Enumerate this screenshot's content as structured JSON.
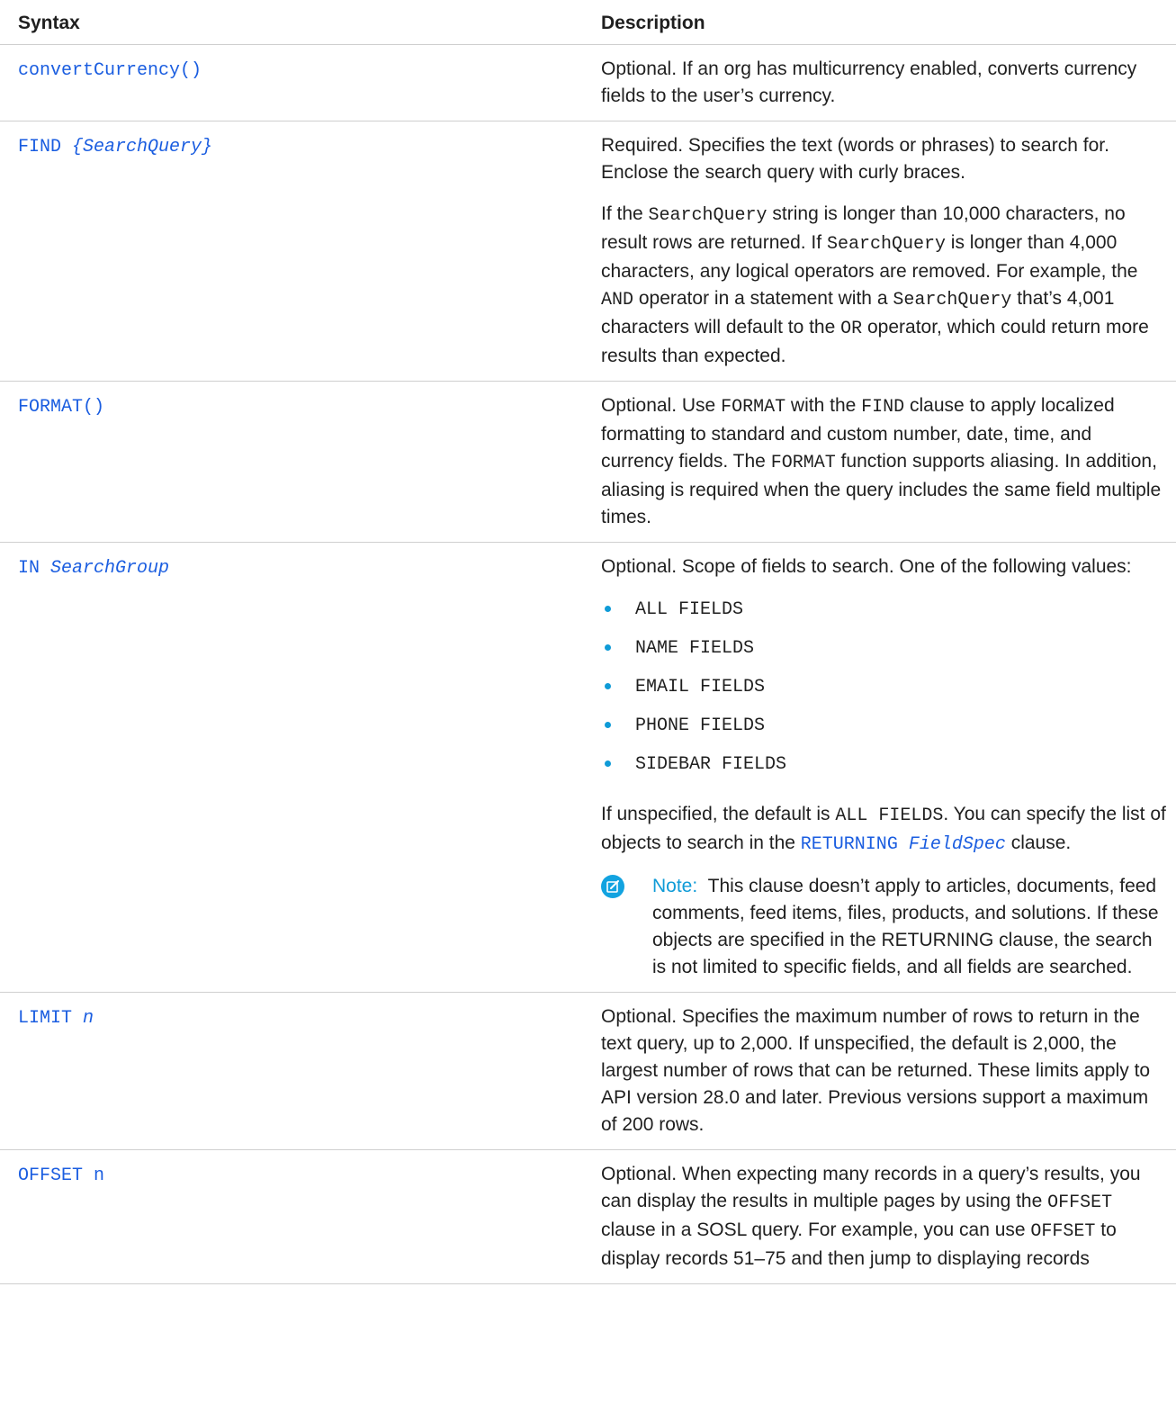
{
  "header": {
    "syntax": "Syntax",
    "description": "Description"
  },
  "rows": [
    {
      "syntax": "convertCurrency()",
      "desc": "Optional. If an org has multicurrency enabled, converts currency fields to the user’s currency."
    },
    {
      "syntax_kw": "FIND",
      "syntax_arg": "{SearchQuery}",
      "desc1": "Required. Specifies the text (words or phrases) to search for. Enclose the search query with curly braces.",
      "p2": {
        "t1": "If the ",
        "c1": "SearchQuery",
        "t2": " string is longer than 10,000 characters, no result rows are returned. If ",
        "c2": "SearchQuery",
        "t3": " is longer than 4,000 characters, any logical operators are removed. For example, the ",
        "c3": "AND",
        "t4": " operator in a statement with a ",
        "c4": "SearchQuery",
        "t5": " that’s 4,001 characters will default to the ",
        "c5": "OR",
        "t6": " operator, which could return more results than expected."
      }
    },
    {
      "syntax": "FORMAT()",
      "p": {
        "t1": "Optional. Use ",
        "c1": "FORMAT",
        "t2": " with the ",
        "c2": "FIND",
        "t3": " clause to apply localized formatting to standard and custom number, date, time, and currency fields. The ",
        "c3": "FORMAT",
        "t4": " function supports aliasing. In addition, aliasing is required when the query includes the same field multiple times."
      }
    },
    {
      "syntax_kw": "IN",
      "syntax_arg": "SearchGroup",
      "desc1": "Optional. Scope of fields to search. One of the following values:",
      "values": [
        "ALL FIELDS",
        "NAME FIELDS",
        "EMAIL FIELDS",
        "PHONE FIELDS",
        "SIDEBAR FIELDS"
      ],
      "p2": {
        "t1": "If unspecified, the default is ",
        "c1": "ALL FIELDS",
        "t2": ". You can specify the list of objects to search in the ",
        "link_kw": "RETURNING",
        "link_arg": "FieldSpec",
        "t3": " clause."
      },
      "note": {
        "label": "Note:",
        "text": "This clause doesn’t apply to articles, documents, feed comments, feed items, files, products, and solutions. If these objects are specified in the RETURNING clause, the search is not limited to specific fields, and all fields are searched."
      }
    },
    {
      "syntax_kw": "LIMIT",
      "syntax_arg": "n",
      "desc": "Optional. Specifies the maximum number of rows to return in the text query, up to 2,000. If unspecified, the default is 2,000, the largest number of rows that can be returned. These limits apply to API version 28.0 and later. Previous versions support a maximum of 200 rows."
    },
    {
      "syntax": "OFFSET n",
      "p": {
        "t1": "Optional. When expecting many records in a query’s results, you can display the results in multiple pages by using the ",
        "c1": "OFFSET",
        "t2": " clause in a SOSL query. For example, you can use ",
        "c2": "OFFSET",
        "t3": " to display records 51–75 and then jump to displaying records"
      }
    }
  ],
  "colors": {
    "link": "#1a5de0",
    "accent": "#0f9bd7",
    "border": "#cfcfcf"
  },
  "icons": {
    "note": "edit-note-icon",
    "bullet": "bullet-dot-icon"
  }
}
